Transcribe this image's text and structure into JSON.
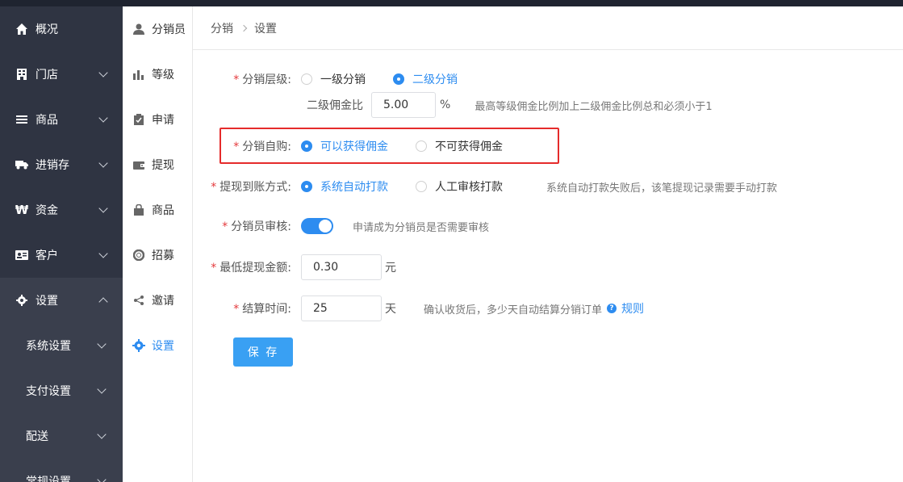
{
  "sidebar": {
    "items": [
      {
        "label": "概况",
        "icon": "home-icon"
      },
      {
        "label": "门店",
        "icon": "store-icon"
      },
      {
        "label": "商品",
        "icon": "list-icon"
      },
      {
        "label": "进销存",
        "icon": "truck-icon"
      },
      {
        "label": "资金",
        "icon": "won-icon"
      },
      {
        "label": "客户",
        "icon": "id-card-icon"
      },
      {
        "label": "设置",
        "icon": "gear-icon"
      }
    ],
    "sub_items": [
      {
        "label": "系统设置"
      },
      {
        "label": "支付设置"
      },
      {
        "label": "配送"
      },
      {
        "label": "常规设置"
      }
    ]
  },
  "subnav": {
    "items": [
      {
        "label": "分销员",
        "icon": "user-icon"
      },
      {
        "label": "等级",
        "icon": "bar-chart-icon"
      },
      {
        "label": "申请",
        "icon": "clipboard-icon"
      },
      {
        "label": "提现",
        "icon": "wallet-icon"
      },
      {
        "label": "商品",
        "icon": "bag-icon"
      },
      {
        "label": "招募",
        "icon": "lifebuoy-icon"
      },
      {
        "label": "邀请",
        "icon": "share-icon"
      },
      {
        "label": "设置",
        "icon": "gear-icon"
      }
    ]
  },
  "breadcrumb": {
    "parent": "分销",
    "current": "设置"
  },
  "form": {
    "level": {
      "label": "分销层级:",
      "opt1": "一级分销",
      "opt2": "二级分销",
      "selected": "二级分销"
    },
    "second_ratio": {
      "label": "二级佣金比",
      "value": "5.00",
      "unit": "%",
      "hint": "最高等级佣金比例加上二级佣金比例总和必须小于1"
    },
    "self_buy": {
      "label": "分销自购:",
      "opt1": "可以获得佣金",
      "opt2": "不可获得佣金",
      "selected": "可以获得佣金"
    },
    "withdraw": {
      "label": "提现到账方式:",
      "opt1": "系统自动打款",
      "opt2": "人工审核打款",
      "selected": "系统自动打款",
      "hint": "系统自动打款失败后，该笔提现记录需要手动打款"
    },
    "review": {
      "label": "分销员审核:",
      "enabled": true,
      "hint": "申请成为分销员是否需要审核"
    },
    "min_withdraw": {
      "label": "最低提现金额:",
      "value": "0.30",
      "unit": "元"
    },
    "settle_time": {
      "label": "结算时间:",
      "value": "25",
      "unit": "天",
      "hint": "确认收货后，多少天自动结算分销订单",
      "help": "?",
      "link": "规则"
    },
    "save": "保 存"
  },
  "colors": {
    "accent": "#2d8cf0",
    "sidebar_bg": "#2f3442",
    "highlight": "#e52b2b"
  }
}
